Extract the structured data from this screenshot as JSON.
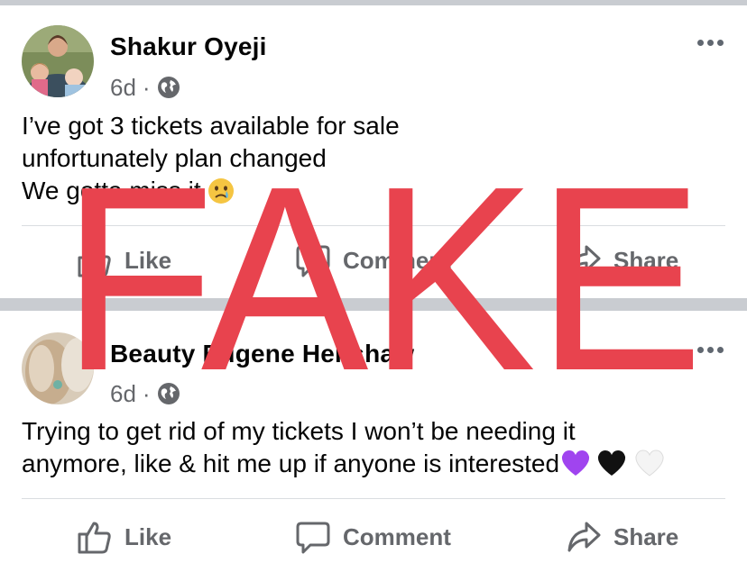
{
  "posts": [
    {
      "author": "Shakur Oyeji",
      "time": "6d",
      "separator": "·",
      "privacy_icon": "globe-icon",
      "lines": [
        "I’ve got 3 tickets available for sale",
        "unfortunately plan changed",
        "We gotta miss it"
      ],
      "emoji": "crying-face",
      "more_icon": "more-dots-icon",
      "actions": {
        "like": "Like",
        "comment": "Comment",
        "share": "Share"
      }
    },
    {
      "author": "Beauty Eugene Henshaw",
      "time": "6d",
      "separator": "·",
      "privacy_icon": "globe-icon",
      "lines": [
        "Trying to get rid of my tickets I won’t be needing it",
        "anymore, like & hit me up if anyone is interested"
      ],
      "emojis": [
        "purple-heart",
        "black-heart",
        "white-heart"
      ],
      "more_icon": "more-dots-icon",
      "actions": {
        "like": "Like",
        "comment": "Comment",
        "share": "Share"
      }
    }
  ],
  "stamp": {
    "text": "FAKE",
    "color": "#e8434e"
  },
  "colors": {
    "separator": "#c9ccd1",
    "meta": "#65676b",
    "text": "#050505"
  }
}
